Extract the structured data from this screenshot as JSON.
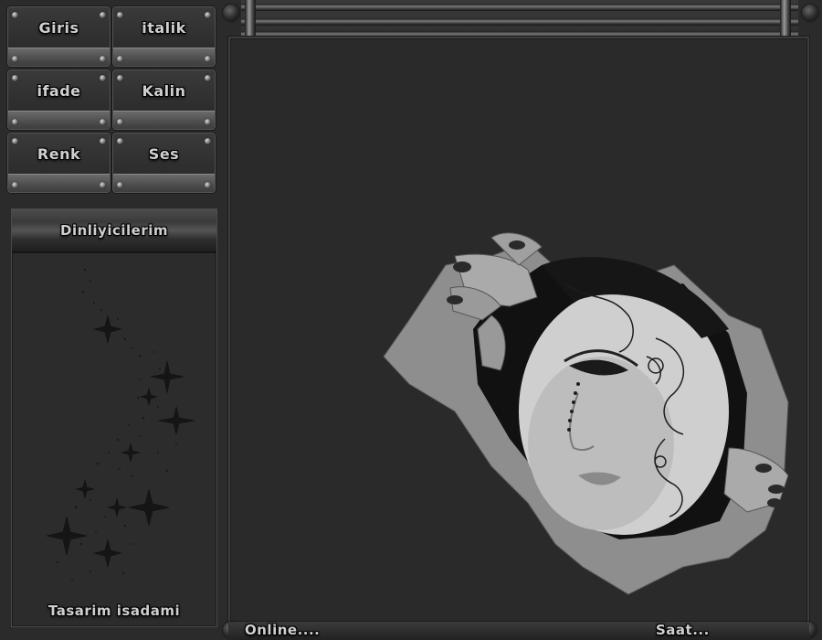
{
  "nav": {
    "buttons": [
      {
        "label": "Giris"
      },
      {
        "label": "italik"
      },
      {
        "label": "ifade"
      },
      {
        "label": "Kalin"
      },
      {
        "label": "Renk"
      },
      {
        "label": "Ses"
      }
    ]
  },
  "side_panel": {
    "header": "Dinliyicilerim",
    "footer": "Tasarim isadami"
  },
  "status_bar": {
    "online": "Online....",
    "clock": "Saat..."
  },
  "colors": {
    "background": "#2b2b2b",
    "frame": "#3d3d3d",
    "chrome_text": "#cfcfcf"
  },
  "icons": [
    "screw-icon",
    "rail-knob-icon",
    "sparkle-decoration-icon"
  ]
}
